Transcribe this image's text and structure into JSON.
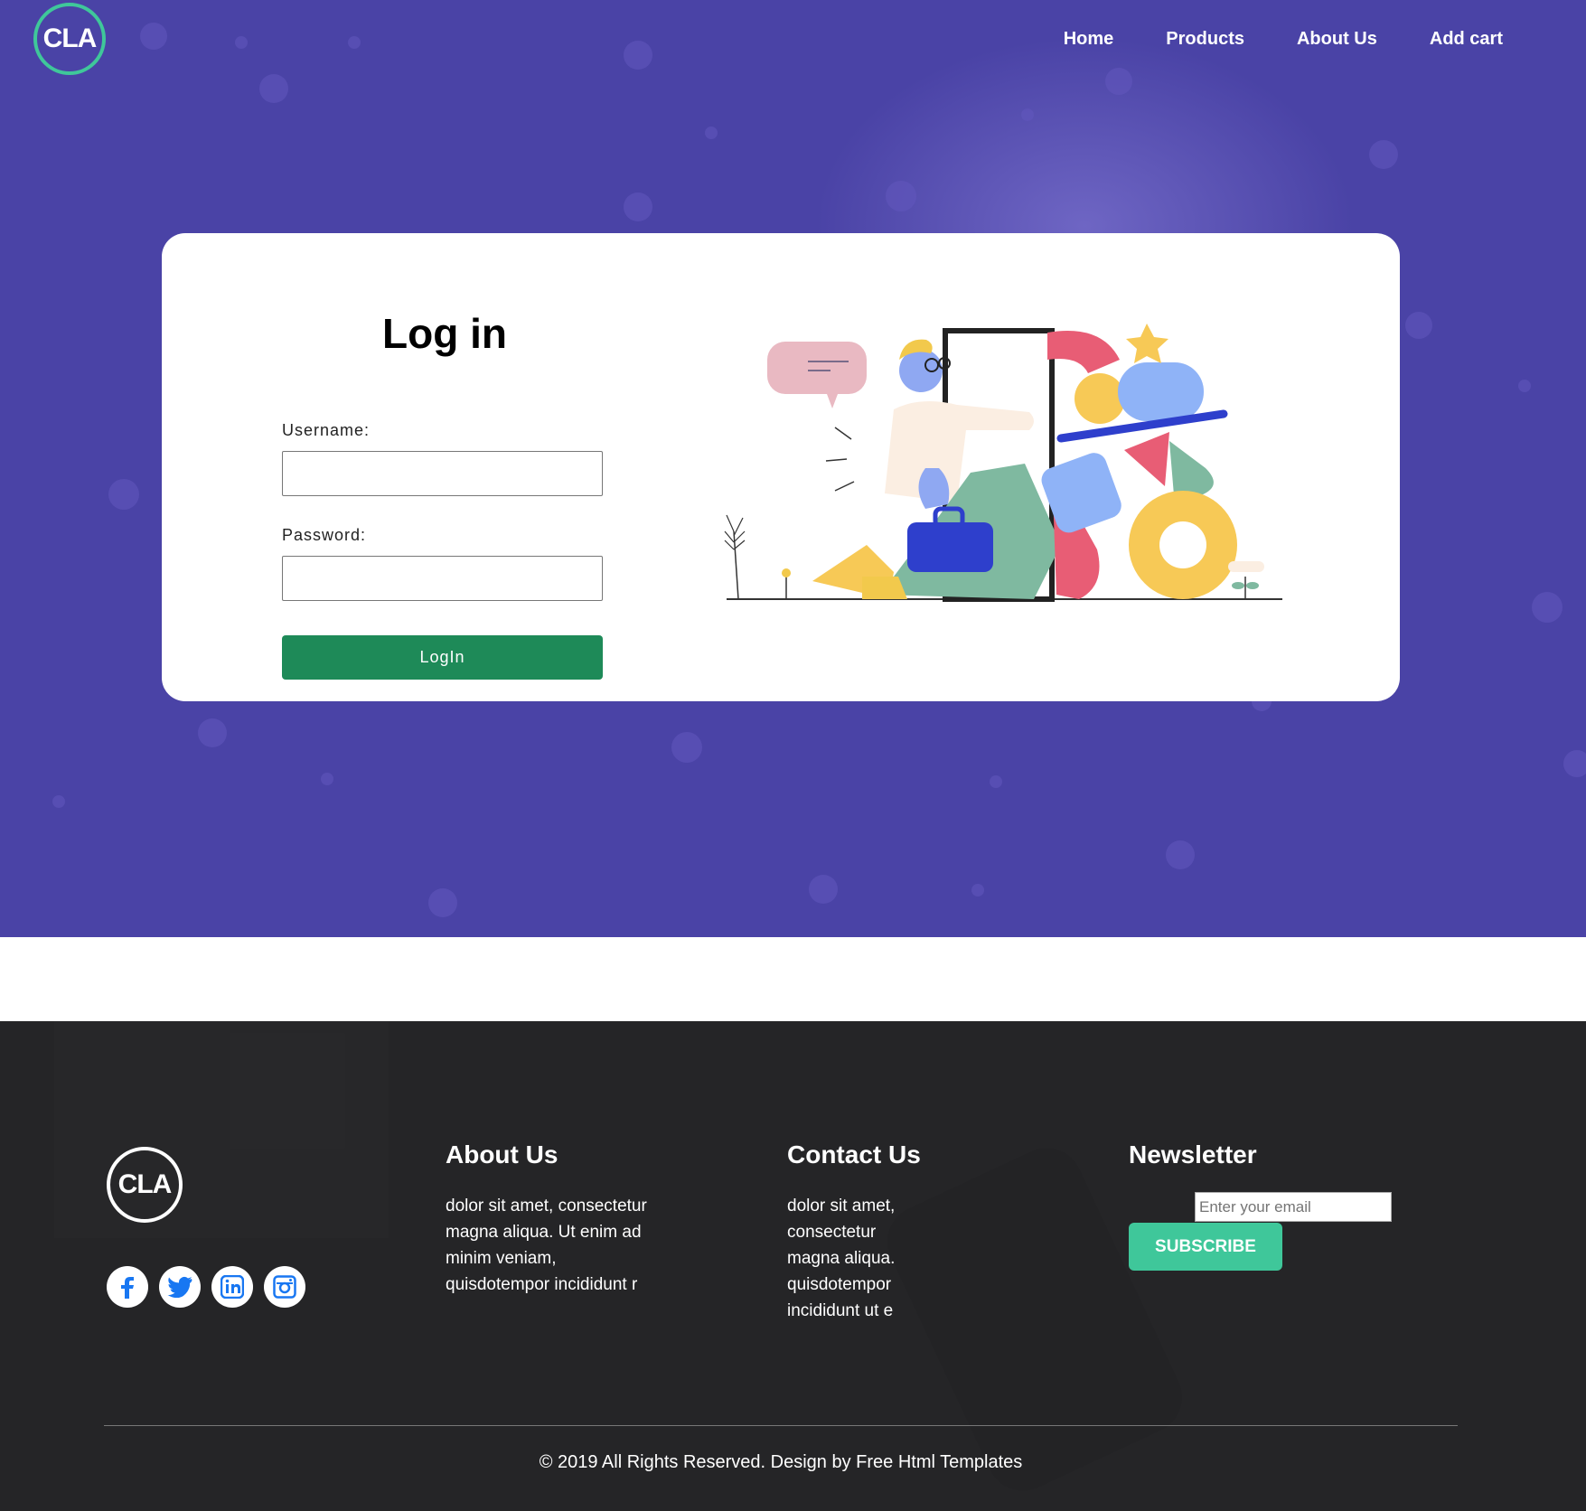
{
  "header": {
    "logo_text": "CLA",
    "nav": [
      "Home",
      "Products",
      "About Us",
      "Add cart"
    ]
  },
  "login": {
    "title": "Log in",
    "username_label": "Username:",
    "username_value": "",
    "password_label": "Password:",
    "password_value": "",
    "submit_label": "LogIn"
  },
  "footer": {
    "logo_text": "CLA",
    "social": [
      "facebook-icon",
      "twitter-icon",
      "linkedin-icon",
      "instagram-icon"
    ],
    "about": {
      "title": "About Us",
      "lines": [
        "dolor sit amet, consectetur",
        "magna aliqua. Ut enim ad",
        "minim veniam,",
        "quisdotempor incididunt r"
      ]
    },
    "contact": {
      "title": "Contact Us",
      "lines": [
        "dolor sit amet,",
        "consectetur",
        "magna aliqua.",
        "quisdotempor",
        "incididunt ut e"
      ]
    },
    "newsletter": {
      "title": "Newsletter",
      "email_placeholder": "Enter your email",
      "subscribe_label": "SUBSCRIBE"
    },
    "copyright": "© 2019 All Rights Reserved. Design by Free Html Templates"
  },
  "colors": {
    "hero_bg": "#4a43a6",
    "accent_green": "#3fc79a",
    "login_button": "#1e8a58",
    "footer_bg": "#252527"
  }
}
